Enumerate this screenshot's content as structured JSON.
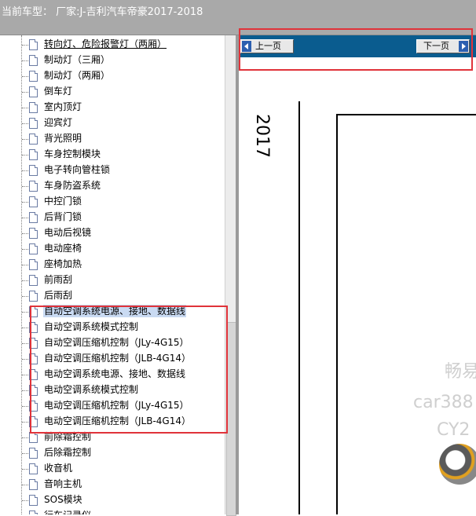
{
  "header": {
    "title": "当前车型：  厂家:J-吉利汽车帝豪2017-2018"
  },
  "tree": {
    "items": [
      {
        "label": "转向灯、危险报警灯（两厢）",
        "underline": true
      },
      {
        "label": "制动灯（三厢）"
      },
      {
        "label": "制动灯（两厢）"
      },
      {
        "label": "倒车灯"
      },
      {
        "label": "室内顶灯"
      },
      {
        "label": "迎宾灯"
      },
      {
        "label": "背光照明"
      },
      {
        "label": "车身控制模块"
      },
      {
        "label": "电子转向管柱锁"
      },
      {
        "label": "车身防盗系统"
      },
      {
        "label": "中控门锁"
      },
      {
        "label": "后背门锁"
      },
      {
        "label": "电动后视镜"
      },
      {
        "label": "电动座椅"
      },
      {
        "label": "座椅加热"
      },
      {
        "label": "前雨刮"
      },
      {
        "label": "后雨刮"
      },
      {
        "label": "自动空调系统电源、接地、数据线",
        "selected": true
      },
      {
        "label": "自动空调系统模式控制"
      },
      {
        "label": "自动空调压缩机控制（JLy-4G15）"
      },
      {
        "label": "自动空调压缩机控制（JLB-4G14）"
      },
      {
        "label": "电动空调系统电源、接地、数据线"
      },
      {
        "label": "电动空调系统模式控制"
      },
      {
        "label": "电动空调压缩机控制（JLy-4G15）"
      },
      {
        "label": "电动空调压缩机控制（JLB-4G14）"
      },
      {
        "label": "前除霜控制"
      },
      {
        "label": "后除霜控制"
      },
      {
        "label": "收音机"
      },
      {
        "label": "音响主机"
      },
      {
        "label": "SOS模块"
      },
      {
        "label": "行车记录仪"
      }
    ]
  },
  "viewer": {
    "prev_label": "上一页",
    "next_label": "下一页",
    "year": "2017",
    "watermark": [
      "畅易",
      "car388",
      "CY2"
    ]
  },
  "colors": {
    "nav_bar": "#0a5c8f",
    "highlight_box": "#e0333a",
    "selected_item": "#c9daf2"
  }
}
